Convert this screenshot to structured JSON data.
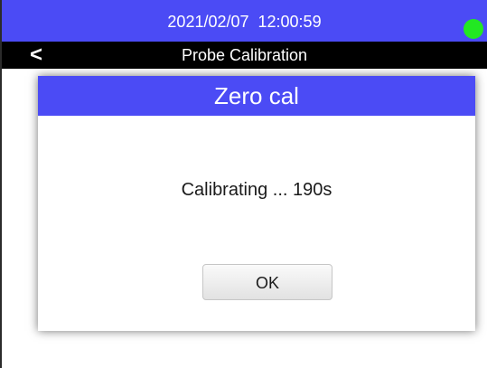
{
  "status_bar": {
    "datetime": "2021/02/07  12:00:59",
    "indicator_icon": "status-dot-icon",
    "indicator_color": "#22e822",
    "background_color": "#4b4bf5"
  },
  "title_bar": {
    "back_label": "<",
    "title": "Probe Calibration"
  },
  "dialog": {
    "title": "Zero cal",
    "message": "Calibrating ... 190s",
    "ok_label": "OK"
  }
}
